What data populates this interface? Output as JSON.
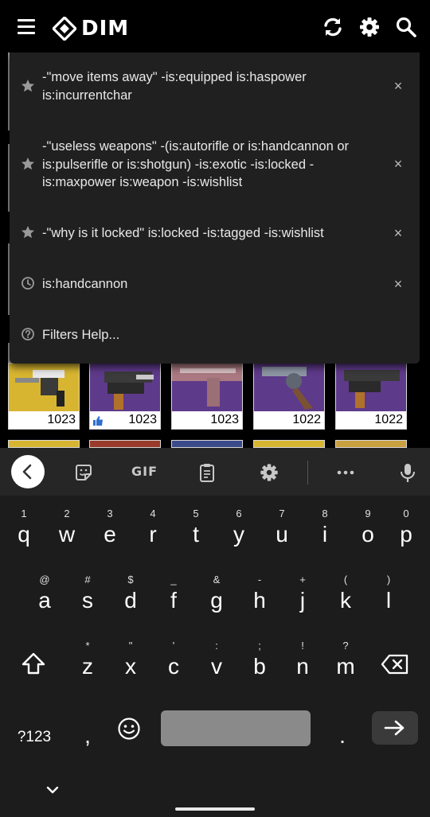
{
  "app": {
    "name": "DIM"
  },
  "inventory": {
    "items": [
      {
        "power": "1023",
        "color": "#d8b531",
        "badge": ""
      },
      {
        "power": "1023",
        "color": "#5e3a8a",
        "badge": "thumbs-up-icon"
      },
      {
        "power": "1023",
        "color": "#5e3a8a",
        "badge": ""
      },
      {
        "power": "1022",
        "color": "#5e3a8a",
        "badge": ""
      },
      {
        "power": "1022",
        "color": "#5e3a8a",
        "badge": ""
      }
    ]
  },
  "suggestions": [
    {
      "icon": "star-icon",
      "text": "-\"move items away\" -is:equipped is:haspower is:incurrentchar",
      "closable": true
    },
    {
      "icon": "star-icon",
      "text": "-\"useless weapons\" -(is:autorifle or is:handcannon or is:pulserifle or is:shotgun) -is:exotic -is:locked -is:maxpower is:weapon -is:wishlist",
      "closable": true
    },
    {
      "icon": "star-icon",
      "text": "-\"why is it locked\" is:locked -is:tagged -is:wishlist",
      "closable": true
    },
    {
      "icon": "clock-icon",
      "text": "is:handcannon",
      "closable": true
    },
    {
      "icon": "help-icon",
      "text": "Filters Help...",
      "closable": false
    }
  ],
  "keyboard": {
    "toolbar": {
      "gif_label": "GIF"
    },
    "rows": [
      [
        {
          "key": "q",
          "hint": "1"
        },
        {
          "key": "w",
          "hint": "2"
        },
        {
          "key": "e",
          "hint": "3"
        },
        {
          "key": "r",
          "hint": "4"
        },
        {
          "key": "t",
          "hint": "5"
        },
        {
          "key": "y",
          "hint": "6"
        },
        {
          "key": "u",
          "hint": "7"
        },
        {
          "key": "i",
          "hint": "8"
        },
        {
          "key": "o",
          "hint": "9"
        },
        {
          "key": "p",
          "hint": "0"
        }
      ],
      [
        {
          "key": "a",
          "hint": "@"
        },
        {
          "key": "s",
          "hint": "#"
        },
        {
          "key": "d",
          "hint": "$"
        },
        {
          "key": "f",
          "hint": "_"
        },
        {
          "key": "g",
          "hint": "&"
        },
        {
          "key": "h",
          "hint": "-"
        },
        {
          "key": "j",
          "hint": "+"
        },
        {
          "key": "k",
          "hint": "("
        },
        {
          "key": "l",
          "hint": ")"
        }
      ],
      [
        {
          "key": "z",
          "hint": "*"
        },
        {
          "key": "x",
          "hint": "\""
        },
        {
          "key": "c",
          "hint": "'"
        },
        {
          "key": "v",
          "hint": ":"
        },
        {
          "key": "b",
          "hint": ";"
        },
        {
          "key": "n",
          "hint": "!"
        },
        {
          "key": "m",
          "hint": "?"
        }
      ]
    ],
    "symbols_label": "?123",
    "comma_label": ",",
    "period_label": "."
  }
}
